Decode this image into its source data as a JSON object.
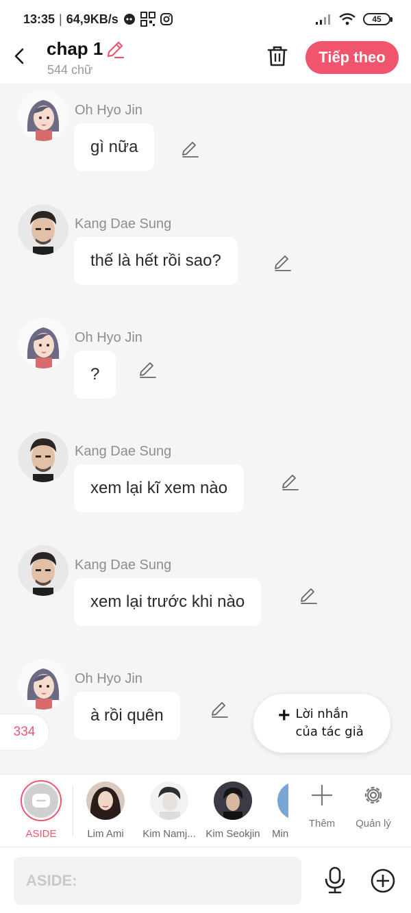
{
  "status_bar": {
    "time": "13:35",
    "speed": "64,9KB/s",
    "battery": "45"
  },
  "header": {
    "title": "chap 1",
    "word_count": "544 chữ",
    "next_button": "Tiếp theo"
  },
  "messages": [
    {
      "sender": "Oh Hyo Jin",
      "text": "gì nữa",
      "avatar": "female-avatar"
    },
    {
      "sender": "Kang Dae Sung",
      "text": "thế là hết rồi sao?",
      "avatar": "male-avatar"
    },
    {
      "sender": "Oh Hyo Jin",
      "text": "?",
      "avatar": "female-avatar"
    },
    {
      "sender": "Kang Dae Sung",
      "text": "xem lại kĩ xem nào",
      "avatar": "male-avatar"
    },
    {
      "sender": "Kang Dae Sung",
      "text": "xem lại trước khi nào",
      "avatar": "male-avatar"
    },
    {
      "sender": "Oh Hyo Jin",
      "text": "à rồi quên",
      "avatar": "female-avatar"
    }
  ],
  "count_badge": "334",
  "author_note": {
    "line1": "Lời nhắn",
    "line2": "của tác giả"
  },
  "characters": {
    "aside": "ASIDE",
    "list": [
      "Lim Ami",
      "Kim Namj...",
      "Kim Seokjin",
      "Min"
    ]
  },
  "tools": {
    "add_label": "Thêm",
    "manage_label": "Quản lý"
  },
  "input": {
    "placeholder": "ASIDE:"
  },
  "colors": {
    "accent": "#f1556e",
    "background": "#f5f5f5"
  }
}
